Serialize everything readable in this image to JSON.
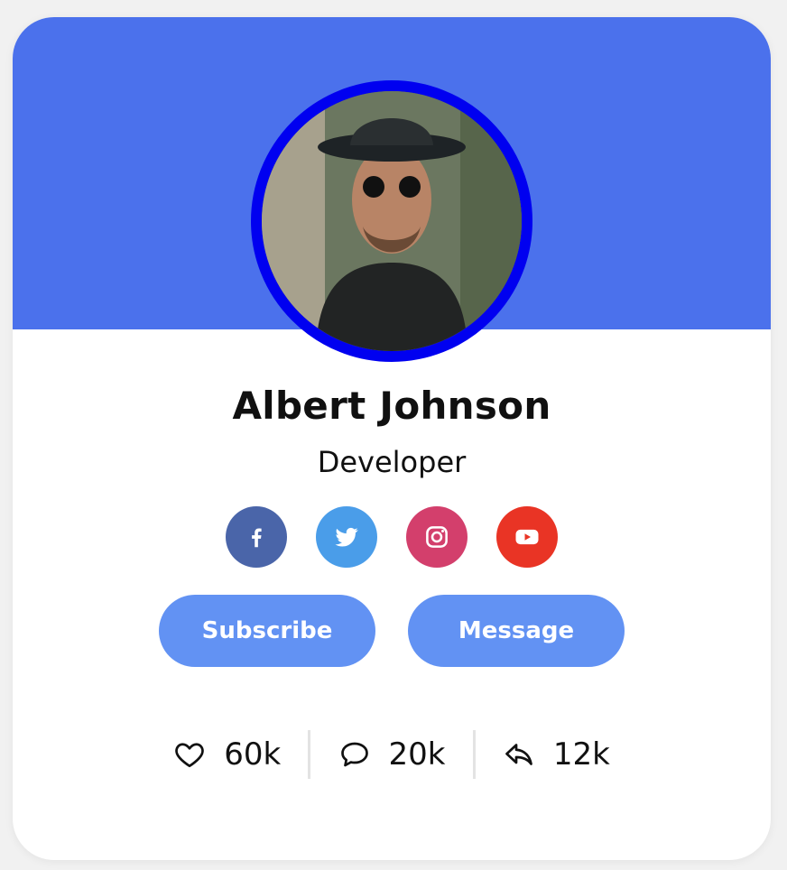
{
  "profile": {
    "name": "Albert Johnson",
    "role": "Developer"
  },
  "socials": [
    {
      "icon": "facebook-icon",
      "color": "#4a65a9"
    },
    {
      "icon": "twitter-icon",
      "color": "#4a9de9"
    },
    {
      "icon": "instagram-icon",
      "color": "#d33f6c"
    },
    {
      "icon": "youtube-icon",
      "color": "#e93425"
    }
  ],
  "actions": {
    "subscribe_label": "Subscribe",
    "message_label": "Message"
  },
  "stats": [
    {
      "icon": "heart-icon",
      "value": "60k"
    },
    {
      "icon": "comment-icon",
      "value": "20k"
    },
    {
      "icon": "reply-icon",
      "value": "12k"
    }
  ],
  "colors": {
    "banner": "#4b71ec",
    "avatar_ring": "#0000f0",
    "button": "#6292f3"
  }
}
